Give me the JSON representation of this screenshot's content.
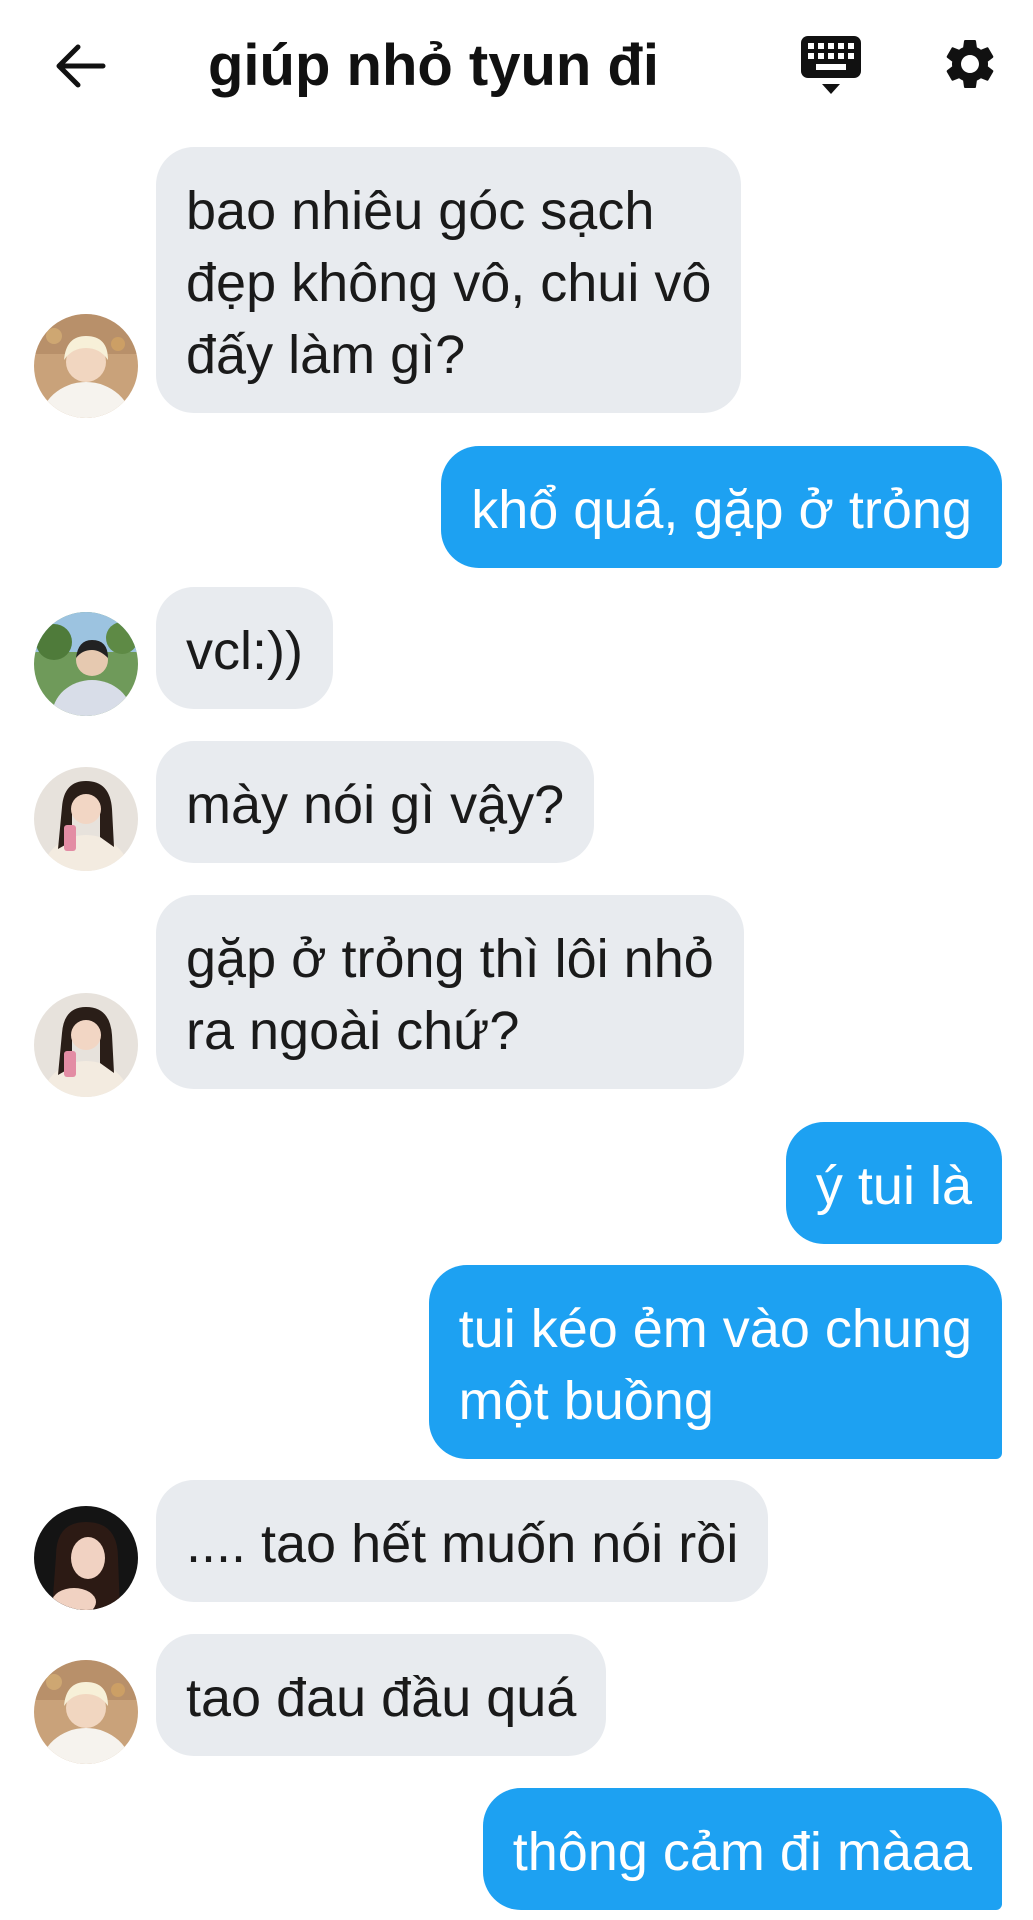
{
  "header": {
    "title": "giúp nhỏ tyun đi",
    "back_icon": "arrow-left-icon",
    "keyboard_icon": "keyboard-icon",
    "settings_icon": "gear-icon"
  },
  "colors": {
    "incoming_bubble": "#e8ebef",
    "outgoing_bubble": "#1da1f2",
    "incoming_text": "#1a1a1a",
    "outgoing_text": "#ffffff"
  },
  "messages": [
    {
      "side": "in",
      "avatar": "avatar-blond-boy",
      "text": "bao nhiêu góc sạch\nđẹp không vô, chui vô\nđấy làm gì?"
    },
    {
      "side": "out",
      "text": "khổ quá, gặp ở trỏng"
    },
    {
      "side": "in",
      "avatar": "avatar-boy-outdoor",
      "text": "vcl:))"
    },
    {
      "side": "in",
      "avatar": "avatar-girl-drink",
      "text": "mày nói gì vậy?"
    },
    {
      "side": "in",
      "avatar": "avatar-girl-drink",
      "text": "gặp ở trỏng thì lôi nhỏ\nra ngoài chứ?"
    },
    {
      "side": "out",
      "text": "ý tui là"
    },
    {
      "side": "out",
      "text": "tui kéo ẻm vào chung\nmột buồng"
    },
    {
      "side": "in",
      "avatar": "avatar-girl-dark",
      "text": ".... tao hết muốn nói rồi"
    },
    {
      "side": "in",
      "avatar": "avatar-blond-boy",
      "text": "tao đau đầu quá"
    },
    {
      "side": "out",
      "text": "thông cảm đi màaa"
    }
  ]
}
